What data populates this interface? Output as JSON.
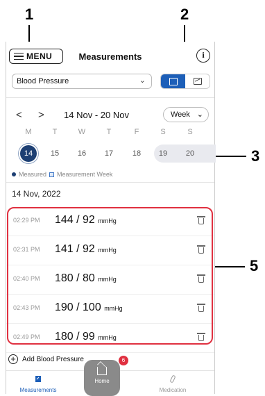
{
  "callouts": [
    "1",
    "2",
    "3",
    "5"
  ],
  "header": {
    "menu_label": "MENU",
    "title": "Measurements",
    "info_label": "i"
  },
  "measurement_type": {
    "selected": "Blood Pressure"
  },
  "week_nav": {
    "prev": "<",
    "next": ">",
    "range": "14 Nov - 20 Nov",
    "period": "Week"
  },
  "weekdays": [
    "M",
    "T",
    "W",
    "T",
    "F",
    "S",
    "S"
  ],
  "days": [
    "14",
    "15",
    "16",
    "17",
    "18",
    "19",
    "20"
  ],
  "legend": {
    "measured": "Measured",
    "measurement_week": "Measurement Week"
  },
  "date_heading": "14 Nov, 2022",
  "measurements": [
    {
      "time": "02:29 PM",
      "value": "144 / 92",
      "unit": "mmHg"
    },
    {
      "time": "02:31 PM",
      "value": "141 / 92",
      "unit": "mmHg"
    },
    {
      "time": "02:40 PM",
      "value": "180 / 80",
      "unit": "mmHg"
    },
    {
      "time": "02:43 PM",
      "value": "190 / 100",
      "unit": "mmHg"
    },
    {
      "time": "02:49 PM",
      "value": "180 / 99",
      "unit": "mmHg"
    }
  ],
  "add_label": "Add Blood Pressure",
  "tabs": {
    "measurements": "Measurements",
    "home": "Home",
    "medication": "Medication"
  },
  "home_badge": "6",
  "colors": {
    "accent": "#1d5fb8",
    "selected_day": "#1d3f73",
    "highlight": "#e03040"
  }
}
